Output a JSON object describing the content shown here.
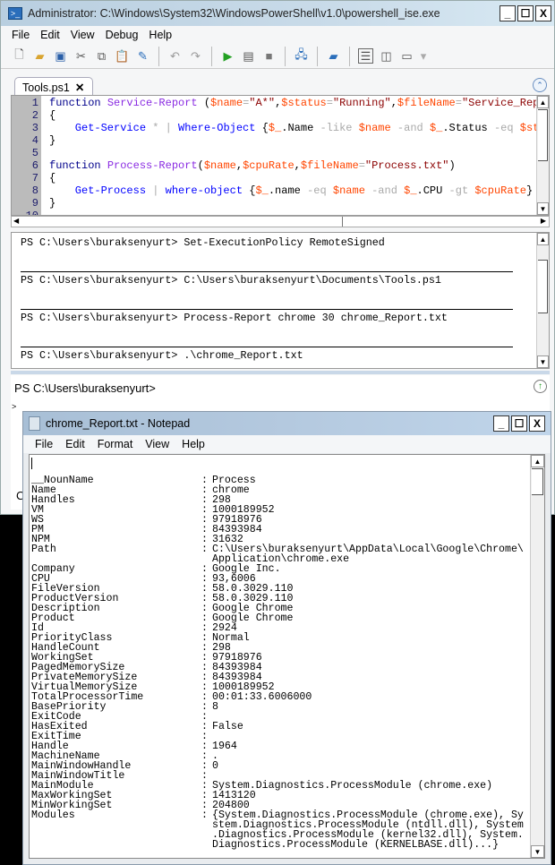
{
  "ise": {
    "title": "Administrator: C:\\Windows\\System32\\WindowsPowerShell\\v1.0\\powershell_ise.exe",
    "window_buttons": [
      "_",
      "☐",
      "X"
    ],
    "menu": [
      "File",
      "Edit",
      "View",
      "Debug",
      "Help"
    ],
    "tab": {
      "label": "Tools.ps1",
      "close": "✕"
    },
    "editor_lines": [
      [
        {
          "t": "function ",
          "c": "kw"
        },
        {
          "t": "Service-Report ",
          "c": "fn"
        },
        {
          "t": "(",
          "c": "pl"
        },
        {
          "t": "$name",
          "c": "var"
        },
        {
          "t": "=",
          "c": "op"
        },
        {
          "t": "\"A*\"",
          "c": "str"
        },
        {
          "t": ",",
          "c": "pl"
        },
        {
          "t": "$status",
          "c": "var"
        },
        {
          "t": "=",
          "c": "op"
        },
        {
          "t": "\"Running\"",
          "c": "str"
        },
        {
          "t": ",",
          "c": "pl"
        },
        {
          "t": "$fileName",
          "c": "var"
        },
        {
          "t": "=",
          "c": "op"
        },
        {
          "t": "\"Service_Rep",
          "c": "str"
        }
      ],
      [
        {
          "t": "{",
          "c": "pl"
        }
      ],
      [
        {
          "t": "    Get-Service ",
          "c": "cmd"
        },
        {
          "t": "* | ",
          "c": "op"
        },
        {
          "t": "Where-Object ",
          "c": "cmd"
        },
        {
          "t": "{",
          "c": "pl"
        },
        {
          "t": "$_",
          "c": "var"
        },
        {
          "t": ".Name ",
          "c": "pl"
        },
        {
          "t": "-like ",
          "c": "op"
        },
        {
          "t": "$name ",
          "c": "var"
        },
        {
          "t": "-and ",
          "c": "op"
        },
        {
          "t": "$_",
          "c": "var"
        },
        {
          "t": ".Status ",
          "c": "pl"
        },
        {
          "t": "-eq ",
          "c": "op"
        },
        {
          "t": "$st",
          "c": "var"
        }
      ],
      [
        {
          "t": "}",
          "c": "pl"
        }
      ],
      [],
      [
        {
          "t": "function ",
          "c": "kw"
        },
        {
          "t": "Process-Report",
          "c": "fn"
        },
        {
          "t": "(",
          "c": "pl"
        },
        {
          "t": "$name",
          "c": "var"
        },
        {
          "t": ",",
          "c": "pl"
        },
        {
          "t": "$cpuRate",
          "c": "var"
        },
        {
          "t": ",",
          "c": "pl"
        },
        {
          "t": "$fileName",
          "c": "var"
        },
        {
          "t": "=",
          "c": "op"
        },
        {
          "t": "\"Process.txt\"",
          "c": "str"
        },
        {
          "t": ")",
          "c": "pl"
        }
      ],
      [
        {
          "t": "{",
          "c": "pl"
        }
      ],
      [
        {
          "t": "    Get-Process ",
          "c": "cmd"
        },
        {
          "t": "| ",
          "c": "op"
        },
        {
          "t": "where-object ",
          "c": "cmd"
        },
        {
          "t": "{",
          "c": "pl"
        },
        {
          "t": "$_",
          "c": "var"
        },
        {
          "t": ".name ",
          "c": "pl"
        },
        {
          "t": "-eq ",
          "c": "op"
        },
        {
          "t": "$name ",
          "c": "var"
        },
        {
          "t": "-and ",
          "c": "op"
        },
        {
          "t": "$_",
          "c": "var"
        },
        {
          "t": ".CPU ",
          "c": "pl"
        },
        {
          "t": "-gt ",
          "c": "op"
        },
        {
          "t": "$cpuRate",
          "c": "var"
        },
        {
          "t": "}",
          "c": "pl"
        }
      ],
      [
        {
          "t": "}",
          "c": "pl"
        }
      ],
      []
    ],
    "console_lines": [
      "PS C:\\Users\\buraksenyurt> Set-ExecutionPolicy RemoteSigned",
      "PS C:\\Users\\buraksenyurt> C:\\Users\\buraksenyurt\\Documents\\Tools.ps1",
      "PS C:\\Users\\buraksenyurt> Process-Report chrome 30 chrome_Report.txt",
      "PS C:\\Users\\buraksenyurt> .\\chrome_Report.txt"
    ],
    "command_prompt": "PS C:\\Users\\buraksenyurt>",
    "input_marker": ">",
    "status_peek": "C"
  },
  "notepad": {
    "title": "chrome_Report.txt - Notepad",
    "window_buttons": [
      "_",
      "☐",
      "X"
    ],
    "menu": [
      "File",
      "Edit",
      "Format",
      "View",
      "Help"
    ],
    "rows": [
      {
        "k": "__NounName",
        "v": "Process"
      },
      {
        "k": "Name",
        "v": "chrome"
      },
      {
        "k": "Handles",
        "v": "298"
      },
      {
        "k": "VM",
        "v": "1000189952"
      },
      {
        "k": "WS",
        "v": "97918976"
      },
      {
        "k": "PM",
        "v": "84393984"
      },
      {
        "k": "NPM",
        "v": "31632"
      },
      {
        "k": "Path",
        "v": "C:\\Users\\buraksenyurt\\AppData\\Local\\Google\\Chrome\\\nApplication\\chrome.exe"
      },
      {
        "k": "Company",
        "v": "Google Inc."
      },
      {
        "k": "CPU",
        "v": "93,6006"
      },
      {
        "k": "FileVersion",
        "v": "58.0.3029.110"
      },
      {
        "k": "ProductVersion",
        "v": "58.0.3029.110"
      },
      {
        "k": "Description",
        "v": "Google Chrome"
      },
      {
        "k": "Product",
        "v": "Google Chrome"
      },
      {
        "k": "Id",
        "v": "2924"
      },
      {
        "k": "PriorityClass",
        "v": "Normal"
      },
      {
        "k": "HandleCount",
        "v": "298"
      },
      {
        "k": "WorkingSet",
        "v": "97918976"
      },
      {
        "k": "PagedMemorySize",
        "v": "84393984"
      },
      {
        "k": "PrivateMemorySize",
        "v": "84393984"
      },
      {
        "k": "VirtualMemorySize",
        "v": "1000189952"
      },
      {
        "k": "TotalProcessorTime",
        "v": "00:01:33.6006000"
      },
      {
        "k": "BasePriority",
        "v": "8"
      },
      {
        "k": "ExitCode",
        "v": ""
      },
      {
        "k": "HasExited",
        "v": "False"
      },
      {
        "k": "ExitTime",
        "v": ""
      },
      {
        "k": "Handle",
        "v": "1964"
      },
      {
        "k": "MachineName",
        "v": "."
      },
      {
        "k": "MainWindowHandle",
        "v": "0"
      },
      {
        "k": "MainWindowTitle",
        "v": ""
      },
      {
        "k": "MainModule",
        "v": "System.Diagnostics.ProcessModule (chrome.exe)"
      },
      {
        "k": "MaxWorkingSet",
        "v": "1413120"
      },
      {
        "k": "MinWorkingSet",
        "v": "204800"
      },
      {
        "k": "Modules",
        "v": "{System.Diagnostics.ProcessModule (chrome.exe), Sy\nstem.Diagnostics.ProcessModule (ntdll.dll), System\n.Diagnostics.ProcessModule (kernel32.dll), System.\nDiagnostics.ProcessModule (KERNELBASE.dll)...}"
      }
    ],
    "separator": ":"
  }
}
